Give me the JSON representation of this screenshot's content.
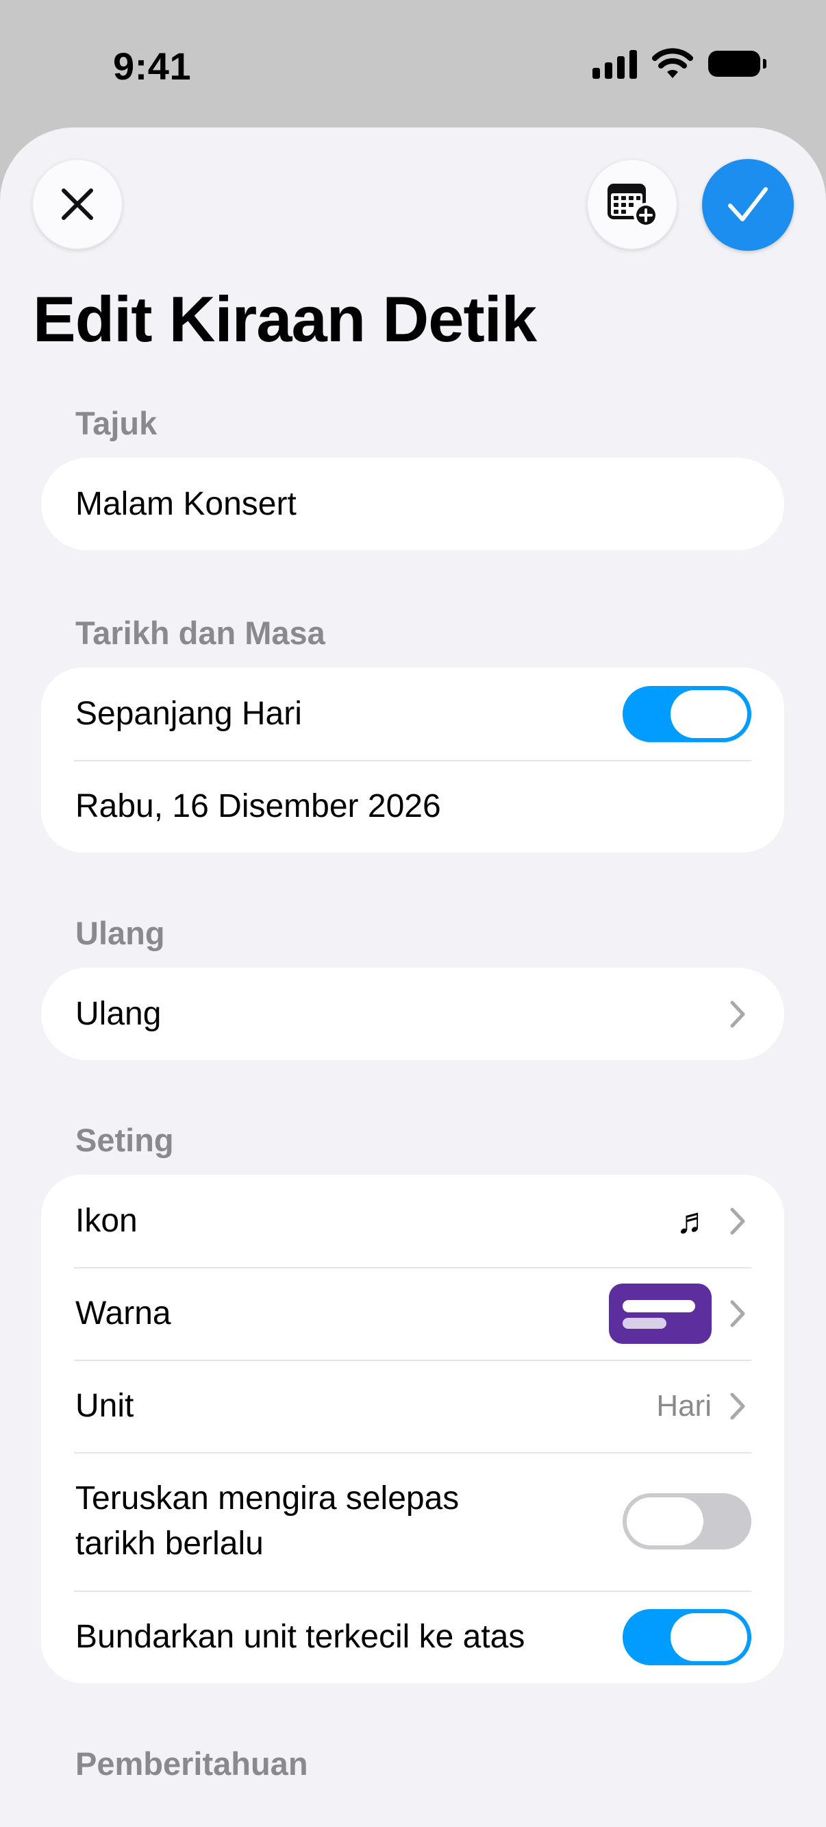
{
  "status_bar": {
    "time": "9:41",
    "icons": [
      "cellular-signal-icon",
      "wifi-icon",
      "battery-icon"
    ]
  },
  "header": {
    "close_icon": "close-icon",
    "calendar_icon": "calendar-add-icon",
    "done_icon": "checkmark-icon",
    "accent_color": "#1c8ef0"
  },
  "page": {
    "title": "Edit Kiraan Detik"
  },
  "sections": {
    "title": {
      "label": "Tajuk",
      "input_value": "Malam Konsert"
    },
    "date_time": {
      "label": "Tarikh dan Masa",
      "all_day_label": "Sepanjang Hari",
      "all_day_on": true,
      "date_value": "Rabu, 16 Disember 2026"
    },
    "repeat": {
      "label": "Ulang",
      "row_label": "Ulang"
    },
    "settings": {
      "label": "Seting",
      "icon_label": "Ikon",
      "icon_value": "♬",
      "color_label": "Warna",
      "color_value": "#5d2e9e",
      "unit_label": "Unit",
      "unit_value": "Hari",
      "continue_label_line1": "Teruskan mengira selepas",
      "continue_label_line2": "tarikh berlalu",
      "continue_on": false,
      "round_label": "Bundarkan unit terkecil ke atas",
      "round_on": true
    },
    "notifications": {
      "label": "Pemberitahuan"
    }
  },
  "toggle_on_color": "#009cff"
}
